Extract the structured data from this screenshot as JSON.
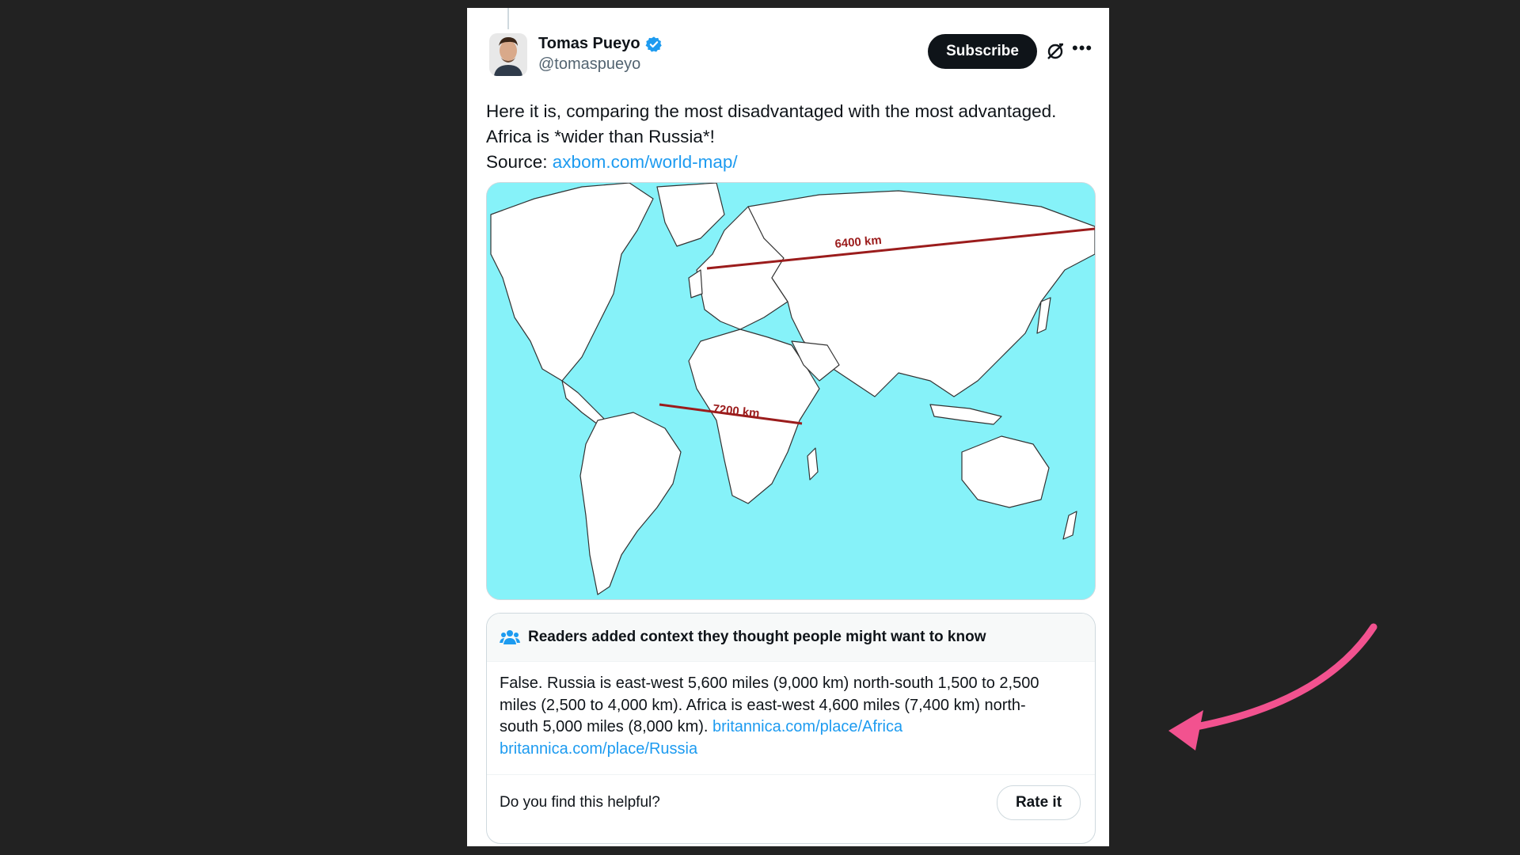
{
  "tweet": {
    "display_name": "Tomas Pueyo",
    "handle": "@tomaspueyo",
    "subscribe_label": "Subscribe",
    "text_line1": "Here it is, comparing the most disadvantaged with the most advantaged.",
    "text_line2": "Africa is *wider than Russia*!",
    "source_prefix": "Source: ",
    "source_link": "axbom.com/world-map/"
  },
  "map": {
    "russia_label": "6400 km",
    "africa_label": "7200 km",
    "ocean_color": "#86f2f9",
    "line_color": "#9b1c1c"
  },
  "community_note": {
    "title": "Readers added context they thought people might want to know",
    "body_line1": "False. Russia is east-west 5,600 miles (9,000 km) north-south 1,500 to 2,500",
    "body_line2": "miles (2,500 to 4,000 km). Africa is east-west 4,600 miles (7,400 km) north-",
    "body_line3_text": "south 5,000 miles (8,000 km). ",
    "link_africa": "britannica.com/place/Africa",
    "link_russia": "britannica.com/place/Russia",
    "helpful_question": "Do you find this helpful?",
    "rate_label": "Rate it"
  },
  "colors": {
    "background": "#222222",
    "link_blue": "#1d9bf0",
    "arrow_pink": "#f2528f"
  }
}
